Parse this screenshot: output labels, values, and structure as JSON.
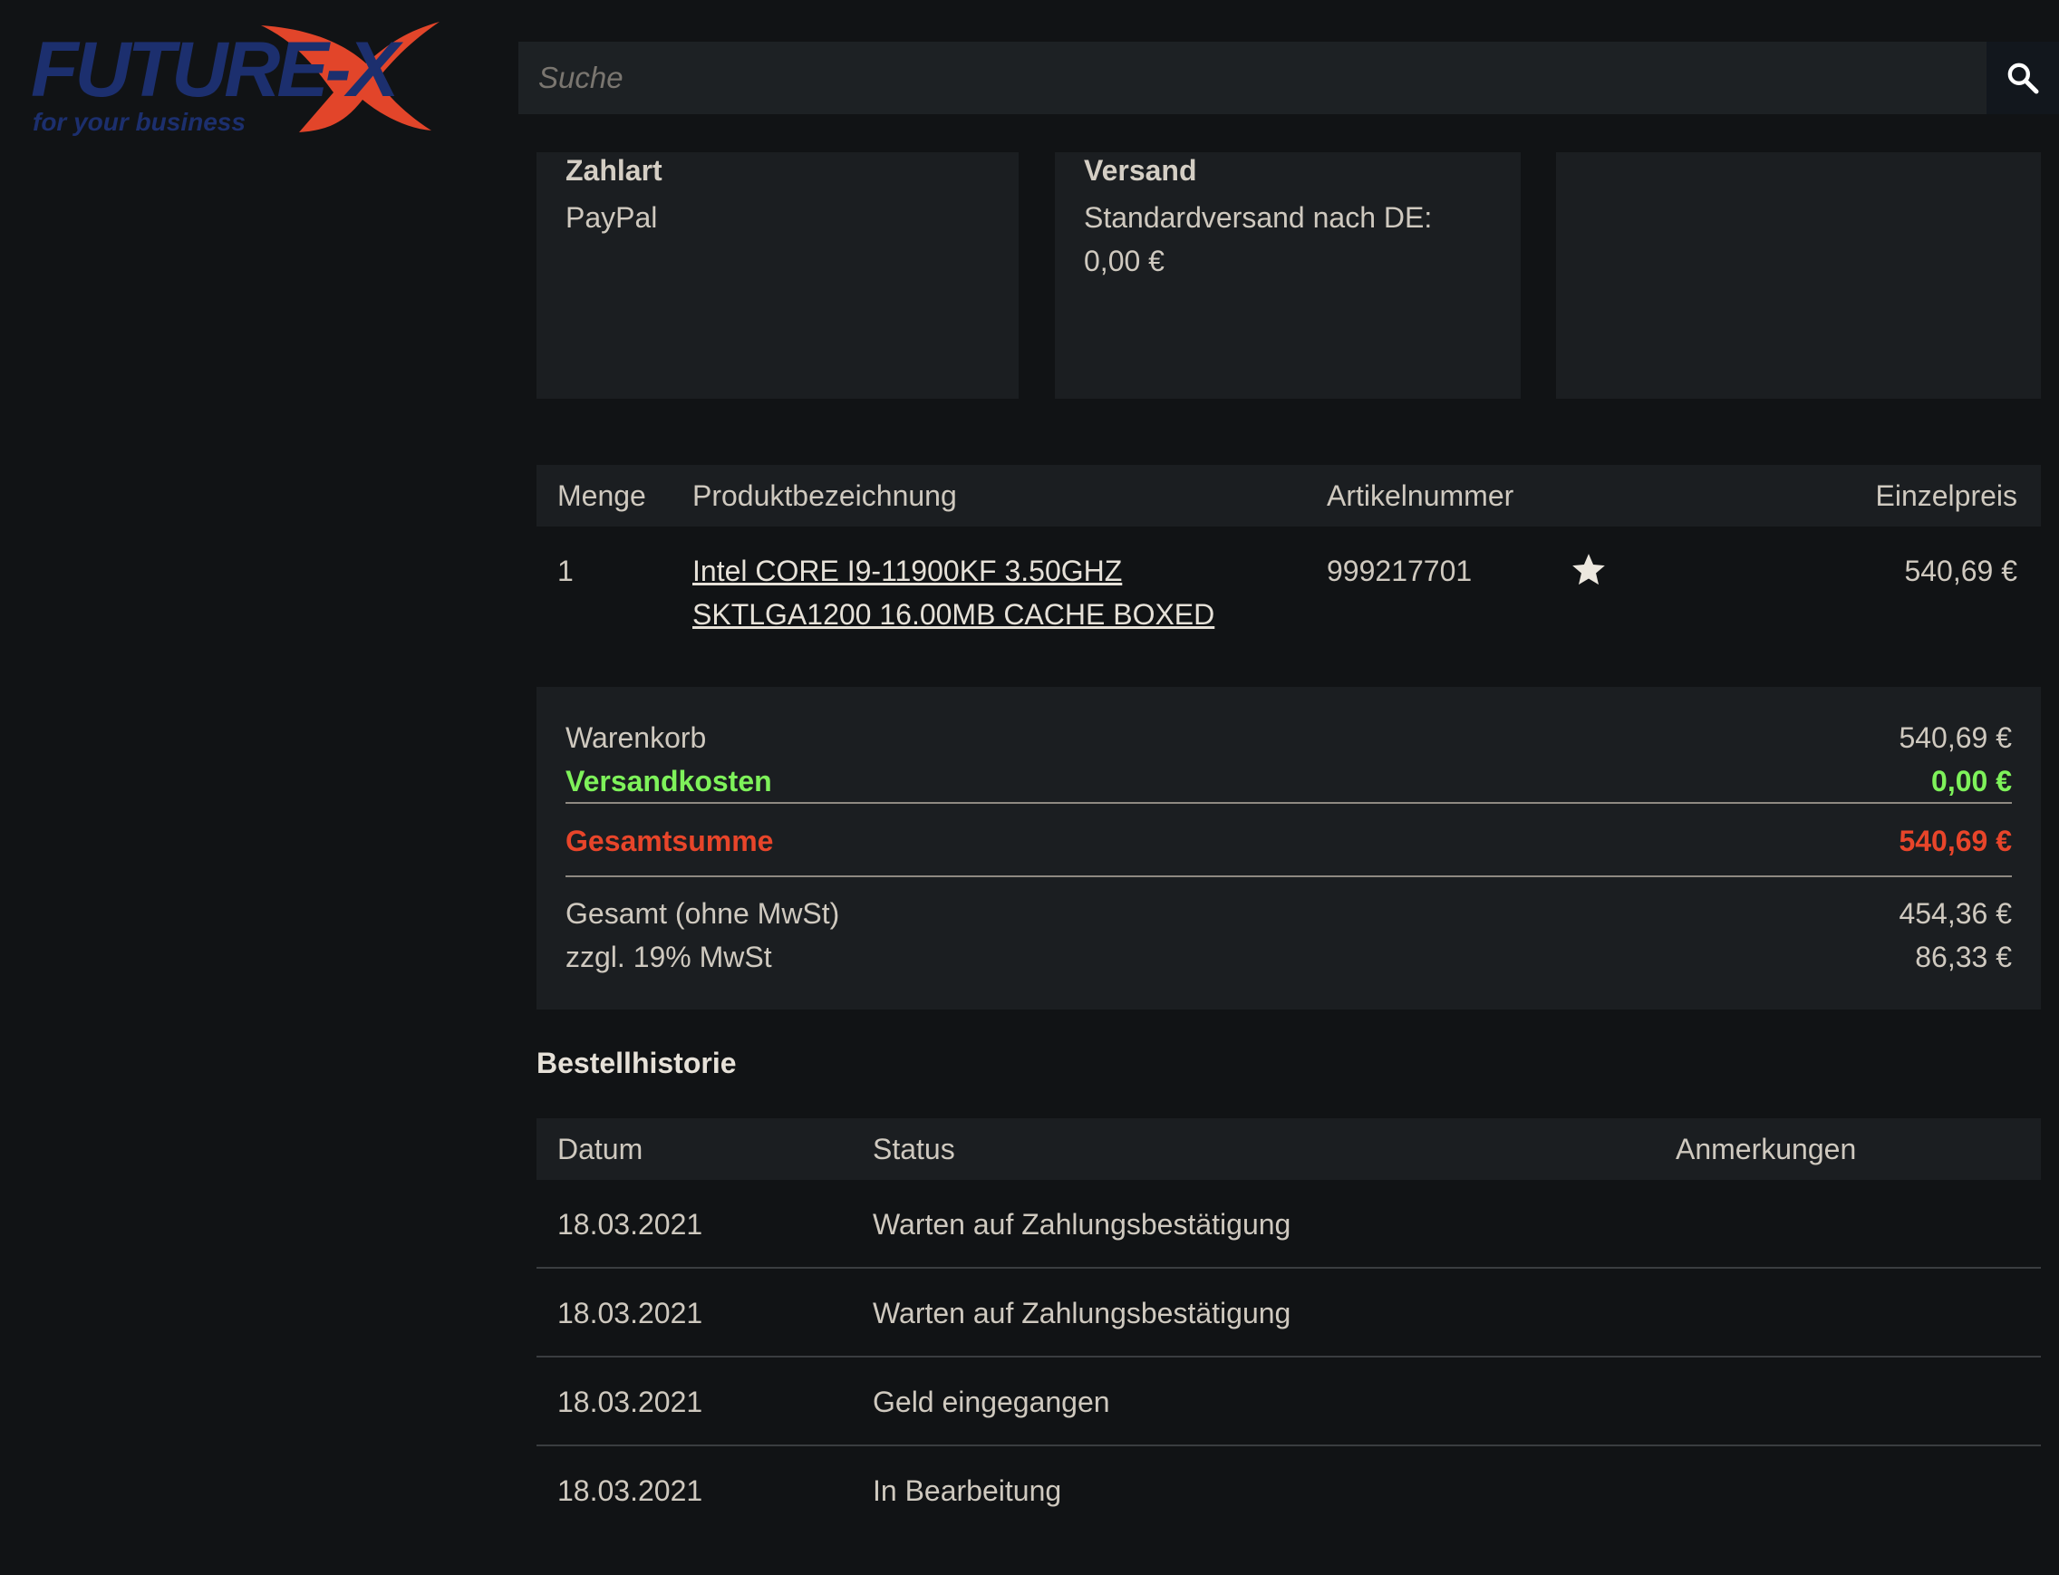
{
  "logo": {
    "brand": "FUTURE-X",
    "tagline": "for your business"
  },
  "search": {
    "placeholder": "Suche"
  },
  "info_boxes": {
    "payment": {
      "title": "Zahlart",
      "value": "PayPal"
    },
    "shipping": {
      "title": "Versand",
      "line1": "Standardversand nach DE:",
      "line2": "0,00 €"
    }
  },
  "products": {
    "headers": {
      "qty": "Menge",
      "name": "Produktbezeichnung",
      "sku": "Artikelnummer",
      "price": "Einzelpreis"
    },
    "rows": [
      {
        "qty": "1",
        "name_line1": "Intel CORE I9-11900KF 3.50GHZ",
        "name_line2": "SKTLGA1200 16.00MB CACHE BOXED",
        "sku": "999217701",
        "price": "540,69 €"
      }
    ]
  },
  "totals": {
    "cart_label": "Warenkorb",
    "cart_value": "540,69 €",
    "shipping_label": "Versandkosten",
    "shipping_value": "0,00 €",
    "total_label": "Gesamtsumme",
    "total_value": "540,69 €",
    "net_label": "Gesamt (ohne MwSt)",
    "net_value": "454,36 €",
    "vat_label": "zzgl. 19% MwSt",
    "vat_value": "86,33 €"
  },
  "history": {
    "title": "Bestellhistorie",
    "headers": {
      "date": "Datum",
      "status": "Status",
      "notes": "Anmerkungen"
    },
    "rows": [
      {
        "date": "18.03.2021",
        "status": "Warten auf Zahlungsbestätigung"
      },
      {
        "date": "18.03.2021",
        "status": "Warten auf Zahlungsbestätigung"
      },
      {
        "date": "18.03.2021",
        "status": "Geld eingegangen"
      },
      {
        "date": "18.03.2021",
        "status": "In Bearbeitung"
      }
    ]
  },
  "colors": {
    "background": "#111315",
    "panel": "#1b1e21",
    "text": "#cfc9bf",
    "green": "#7ef25a",
    "red": "#e8452a",
    "logo_blue": "#1c2f6e",
    "logo_red": "#e2452a"
  },
  "icons": {
    "search": "search-icon",
    "favorite": "star-icon"
  }
}
